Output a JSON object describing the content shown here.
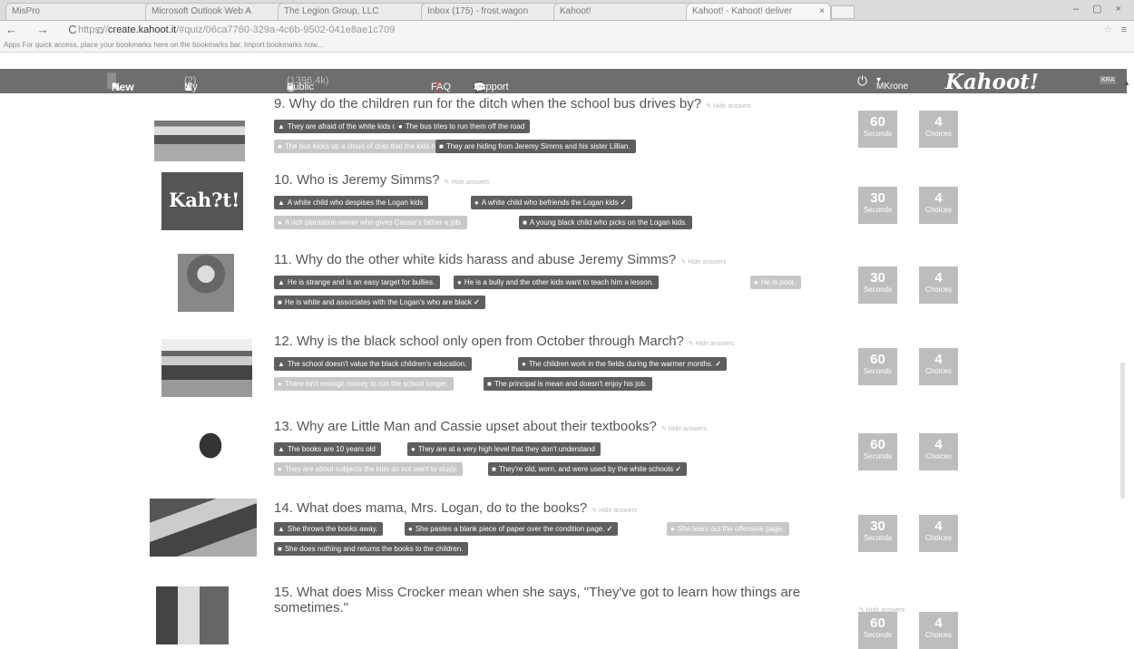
{
  "browser": {
    "tabs": [
      "MisPro",
      "Microsoft Outlook Web A",
      "The Legion Group, LLC",
      "Inbox (175) - frost.wagon",
      "Kahoot!",
      "Kahoot! - Kahoot! deliver"
    ],
    "tab_close": "×",
    "window_controls": "– ▢ ×",
    "nav_glyphs": "← → C ⌂",
    "url_prefix": "https://",
    "url_host": "create.kahoot.it",
    "url_rest": "/#quiz/06ca7760-329a-4c6b-9502-041e8ae1c709",
    "bookmarks_text": "Apps  For quick access, place your bookmarks here on the bookmarks bar. Import bookmarks now..."
  },
  "nav": {
    "new_label": "New K!",
    "my_kahoots": "My Kahoots",
    "my_count": "(2)",
    "public_kahoots": "Public Kahoots",
    "public_count": "(1396.4k)",
    "faq": "FAQ",
    "support": "Support",
    "user": "MKrone",
    "logo": "Kahoot!",
    "flag": "KRA"
  },
  "hide_label": "Hide answers",
  "questions": [
    {
      "title": "9. Why do the children run for the ditch when the school bus drives by?",
      "answers": [
        {
          "text": "They are afraid of the white kids on the bus",
          "icon": "▲",
          "correct": false
        },
        {
          "text": "The bus tries to run them off the road",
          "icon": "●",
          "correct": false
        },
        {
          "text": "The bus kicks up a cloud of dust that the kids run from.",
          "icon": "●",
          "correct": true
        },
        {
          "text": "They are hiding from Jeremy Simms and his sister Lillian.",
          "icon": "■",
          "correct": false
        }
      ],
      "time": "60",
      "time_label": "Seconds",
      "choices": "4",
      "choices_label": "Choices"
    },
    {
      "title": "10. Who is Jeremy Simms?",
      "answers": [
        {
          "text": "A white child who despises the Logan kids",
          "icon": "▲",
          "correct": false
        },
        {
          "text": "A white child who befriends the Logan kids",
          "icon": "●",
          "correct": true
        },
        {
          "text": "A rich plantation owner who gives Cassie's father a job.",
          "icon": "●",
          "correct": false
        },
        {
          "text": "A young black child who picks on the Logan kids.",
          "icon": "■",
          "correct": false
        }
      ],
      "time": "30",
      "time_label": "Seconds",
      "choices": "4",
      "choices_label": "Choices"
    },
    {
      "title": "11. Why do the other white kids harass and abuse Jeremy Simms?",
      "answers": [
        {
          "text": "He is strange and is an easy target for bullies.",
          "icon": "▲",
          "correct": false
        },
        {
          "text": "He is a bully and the other kids want to teach him a lesson.",
          "icon": "●",
          "correct": false
        },
        {
          "text": "He is poor.",
          "icon": "●",
          "correct": false
        },
        {
          "text": "He is white and associates with the Logan's who are black",
          "icon": "■",
          "correct": true
        }
      ],
      "time": "30",
      "time_label": "Seconds",
      "choices": "4",
      "choices_label": "Choices"
    },
    {
      "title": "12. Why is the black school only open from October through March?",
      "answers": [
        {
          "text": "The school doesn't value the black children's education.",
          "icon": "▲",
          "correct": false
        },
        {
          "text": "The children work in the fields during the warmer months.",
          "icon": "●",
          "correct": true
        },
        {
          "text": "There isn't enough money to run the school longer.",
          "icon": "●",
          "correct": false
        },
        {
          "text": "The principal is mean and doesn't enjoy his job.",
          "icon": "■",
          "correct": false
        }
      ],
      "time": "60",
      "time_label": "Seconds",
      "choices": "4",
      "choices_label": "Choices"
    },
    {
      "title": "13. Why are Little Man and Cassie upset about their textbooks?",
      "answers": [
        {
          "text": "The books are 10 years old",
          "icon": "▲",
          "correct": false
        },
        {
          "text": "They are at a very high level that they don't understand",
          "icon": "●",
          "correct": false
        },
        {
          "text": "They are about subjects the kids do not want to study.",
          "icon": "●",
          "correct": false
        },
        {
          "text": "They're old, worn, and were used by the white schools",
          "icon": "■",
          "correct": true
        }
      ],
      "time": "60",
      "time_label": "Seconds",
      "choices": "4",
      "choices_label": "Choices"
    },
    {
      "title": "14. What does mama, Mrs. Logan, do to the books?",
      "answers": [
        {
          "text": "She throws the books away.",
          "icon": "▲",
          "correct": false
        },
        {
          "text": "She pastes a blank piece of paper over the condition page.",
          "icon": "●",
          "correct": true
        },
        {
          "text": "She tears out the offensive page.",
          "icon": "●",
          "correct": false
        },
        {
          "text": "She does nothing and returns the books to the children.",
          "icon": "■",
          "correct": false
        }
      ],
      "time": "30",
      "time_label": "Seconds",
      "choices": "4",
      "choices_label": "Choices"
    },
    {
      "title": "15. What does Miss Crocker mean when she says, \"They've got to learn how things are sometimes.\"",
      "answers": [],
      "time": "60",
      "time_label": "Seconds",
      "choices": "4",
      "choices_label": "Choices"
    }
  ],
  "kahoot_placeholder_text": "Kah?t!",
  "colors": {
    "nav": "#6e6e6e",
    "answer": "#5e5e5e",
    "answer_pale": "#c8c8c8",
    "box": "#bdbdbd"
  }
}
